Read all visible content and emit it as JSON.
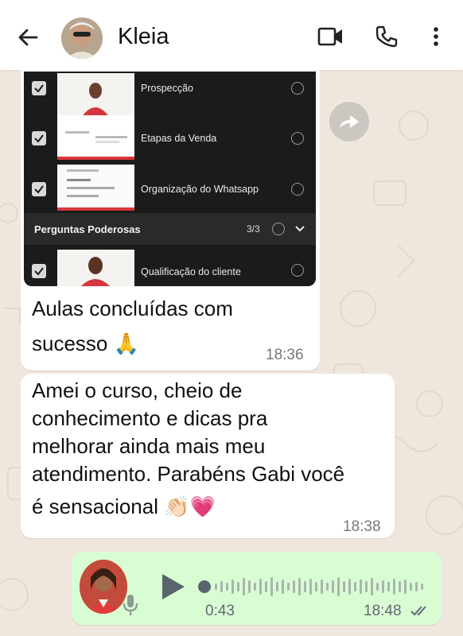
{
  "header": {
    "contact_name": "Kleia",
    "icons": [
      "back-arrow-icon",
      "video-call-icon",
      "phone-icon",
      "more-vert-icon"
    ]
  },
  "messages": [
    {
      "type": "image-with-caption",
      "screenshot": {
        "rows": [
          {
            "label": "Prospecção"
          },
          {
            "label": "Etapas da Venda"
          },
          {
            "label": "Organização do Whatsapp"
          }
        ],
        "section": {
          "title": "Perguntas Poderosas",
          "count": "3/3"
        },
        "section_rows": [
          {
            "label": "Qualificação do cliente"
          }
        ]
      },
      "caption_line1": "Aulas concluídas com",
      "caption_line2": "sucesso 🙏",
      "time": "18:36"
    },
    {
      "type": "text",
      "lines": [
        "Amei o curso, cheio de",
        "conhecimento e dicas pra",
        "melhorar ainda mais meu",
        "atendimento. Parabéns Gabi você",
        "é sensacional 👏🏻💗"
      ],
      "time": "18:38"
    },
    {
      "type": "voice",
      "duration": "0:43",
      "time": "18:48",
      "status": "delivered"
    }
  ],
  "colors": {
    "chat_bg": "#efe7dd",
    "incoming": "#ffffff",
    "outgoing": "#d9fdd3"
  }
}
